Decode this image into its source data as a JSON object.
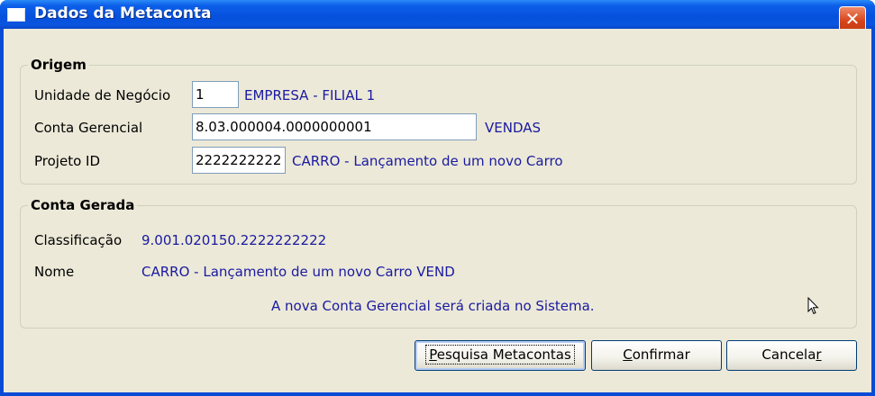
{
  "window": {
    "title": "Dados da Metaconta",
    "close_symbol": "✕"
  },
  "origem": {
    "legend": "Origem",
    "unidade": {
      "label": "Unidade de Negócio",
      "value": "1",
      "desc": "EMPRESA - FILIAL 1"
    },
    "conta": {
      "label": "Conta Gerencial",
      "value": "8.03.000004.0000000001",
      "desc": "VENDAS"
    },
    "projeto": {
      "label": "Projeto ID",
      "value": "2222222222",
      "desc": "CARRO - Lançamento de um novo Carro"
    }
  },
  "gerada": {
    "legend": "Conta Gerada",
    "classificacao": {
      "label": "Classificação",
      "value": "9.001.020150.2222222222"
    },
    "nome": {
      "label": "Nome",
      "value": "CARRO - Lançamento de um novo Carro VEND"
    },
    "message": "A nova Conta Gerencial será criada no Sistema."
  },
  "buttons": {
    "pesquisa": {
      "pre": "",
      "accel": "P",
      "post": "esquisa Metacontas"
    },
    "confirmar": {
      "pre": "",
      "accel": "C",
      "post": "onfirmar"
    },
    "cancelar": {
      "pre": "Cancela",
      "accel": "r",
      "post": ""
    }
  },
  "icons": {
    "window": "window-icon",
    "close": "close-icon",
    "cursor": "mouse-cursor-icon"
  },
  "colors": {
    "titlebar": "#0650dc",
    "close": "#d6451b",
    "value_text": "#1a1aa0",
    "panel": "#ece9d8"
  }
}
